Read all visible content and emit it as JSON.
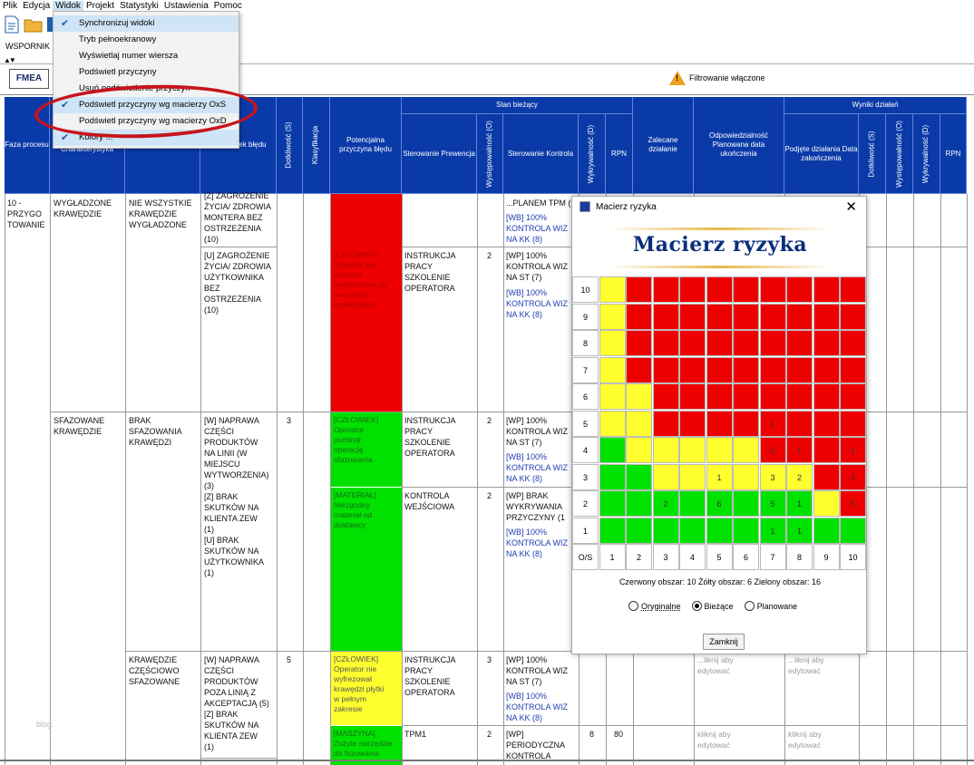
{
  "menubar": {
    "items": [
      "Plik",
      "Edycja",
      "Widok",
      "Projekt",
      "Statystyki",
      "Ustawienia",
      "Pomoc"
    ]
  },
  "toolbar": {
    "project_label": "WSPORNIK",
    "fmea_button": "FMEA",
    "filter_status": "Filtrowanie włączone"
  },
  "view_menu": {
    "items": [
      {
        "label": "Synchronizuj widoki",
        "checked": true
      },
      {
        "label": "Tryb pełnoekranowy",
        "checked": false
      },
      {
        "label": "Wyświetlaj numer wiersza",
        "checked": false
      },
      {
        "label": "Podświetl przyczyny",
        "checked": false
      },
      {
        "label": "Usuń podświetlenie przyczyn",
        "checked": false
      },
      {
        "label": "Podświetl przyczyny wg macierzy OxS",
        "checked": true
      },
      {
        "label": "Podświetl przyczyny wg macierzy OxD",
        "checked": false
      },
      {
        "label": "Kolory ...",
        "checked": true
      }
    ]
  },
  "table_header": {
    "faza": "Faza\nprocesu",
    "funkcja": "Funkcja /\nCharakterystyka",
    "rodzaj": "błędu",
    "skutek": "...ny skutek\nbłędu",
    "dotkliwosc": "Dotkliwość (S)",
    "klasyfikacja": "Klasyfikacja",
    "przyczyna": "Potencjalna\nprzyczyna błędu",
    "stan_biezacy": "Stan bieżący",
    "sterowanie_prewencja": "Sterowanie\nPrewencja",
    "wystepowalnosc": "Występowalność (O)",
    "sterowanie_kontrola": "Sterowanie\nKontrola",
    "wykrywalnosc": "Wykrywalność (D)",
    "rpn": "RPN",
    "zalecane": "Zalecane\ndziałanie",
    "odpowiedzialnosc": "Odpowiedzialność\nPlanowana data\nukończenia",
    "wyniki": "Wyniki działań",
    "podjete": "Podjęte działania\nData zakończenia",
    "dotkliwosc2": "Dotkliwość (S)",
    "wystepowalnosc2": "Występowalność (O)",
    "wykrywalnosc2": "Wykrywalność (D)",
    "rpn2": "RPN"
  },
  "rows": {
    "faza1": "10 -\nPRZYGO\nTOWANIE",
    "funkcja1": "WYGŁADZONE\nKRAWĘDZIE",
    "rodzaj1": "NIE WSZYSTKIE\nKRAWĘDZIE\nWYGŁADZONE",
    "skutek1a": "[Z] ZAGROŻENIE\nŻYCIA/ ZDROWIA\nMONTERA BEZ\nOSTRZEŻENIA\n(10)",
    "skutek1b": "[U] ZAGROŻENIE\nŻYCIA/ ZDROWIA\nUŻYTKOWNIKA\nBEZ\nOSTRZEŻENIA\n(10)",
    "przyczyna1": "[CZŁOWIEK]\nOperator nie\nwykonał\nwygładzania na\nwszystkich\nkrawędziach",
    "prewencja1": "INSTRUKCJA\nPRACY\nSZKOLENIE\nOPERATORA",
    "o1": "2",
    "kontrola1a": "...PLANEM TPM (9",
    "kontrola1b": "[WB] 100%\nKONTROLA WIZ\nNA KK (8)",
    "kontrola1c": "[WP] 100%\nKONTROLA WIZ\nNA ST (7)",
    "kontrola1d": "[WB] 100%\nKONTROLA WIZ\nNA KK (8)",
    "funkcja2": "SFAZOWANE\nKRAWĘDZIE",
    "rodzaj2": "BRAK\nSFAZOWANIA\nKRAWĘDZI",
    "skutek2": "[W] NAPRAWA\nCZĘŚCI\nPRODUKTÓW\nNA LINII (W\nMIEJSCU\nWYTWORZENIA)\n(3)\n[Z] BRAK\nSKUTKÓW NA\nKLIENTA ZEW\n(1)\n[U] BRAK\nSKUTKÓW NA\nUŻYTKOWNIKA\n(1)",
    "s2": "3",
    "przyczyna2a": "[CZŁOWIEK]\nOperator\npominął\noperację\nsfazowania",
    "prewencja2a": "INSTRUKCJA\nPRACY\nSZKOLENIE\nOPERATORA",
    "o2a": "2",
    "kontrola2a": "[WP] 100%\nKONTROLA WIZ\nNA ST (7)",
    "kontrola2b": "[WB] 100%\nKONTROLA WIZ\nNA KK (8)",
    "przyczyna2b": "[MATERIAŁ]\nNiezgodny\nmateriał od\ndostawcy",
    "prewencja2b": "KONTROLA\nWEJŚCIOWA",
    "o2b": "2",
    "kontrola2c": "[WP] BRAK\nWYKRYWANIA\nPRZYCZYNY (1",
    "kontrola2d": "[WB] 100%\nKONTROLA WIZ\nNA KK (8)",
    "rodzaj3": "KRAWĘDZIE\nCZĘŚCIOWO\nSFAZOWANE",
    "skutek3": "[W] NAPRAWA\nCZĘŚCI\nPRODUKTÓW\nPOZA LINIĄ Z\nAKCEPTACJĄ (5)\n[Z] BRAK\nSKUTKÓW NA\nKLIENTA ZEW\n(1)",
    "s3": "5",
    "przyczyna3a": "[CZŁOWIEK]\nOperator nie\nwyfrezował\nkrawędzi płytki\nw pełnym\nzakresie",
    "prewencja3a": "INSTRUKCJA\nPRACY\nSZKOLENIE\nOPERATORA",
    "o3a": "3",
    "kontrola3a": "[WP] 100%\nKONTROLA WIZ\nNA ST (7)",
    "kontrola3b": "[WB] 100%\nKONTROLA WIZ\nNA KK (8)",
    "przyczyna3b": "[MASZYNA]\nZużyte narzędzie\ndo fazowania",
    "prewencja3b": "TPM1",
    "o3b": "2",
    "kontrola3c": "[WP]\nPERIODYCZNA\nKONTROLA",
    "d3b": "8",
    "rpn3b": "80",
    "placeholder1": "...liknij aby\nedytować",
    "placeholder2": "...liknij aby\nedytować",
    "placeholder3": "kliknij aby\nedytować",
    "placeholder4": "kliknij aby\nedytować",
    "watermark": "blog"
  },
  "dialog": {
    "title": "Macierz ryzyka",
    "heading": "Macierz ryzyka",
    "os_label": "O/S",
    "x_labels": [
      "1",
      "2",
      "3",
      "4",
      "5",
      "6",
      "7",
      "8",
      "9",
      "10"
    ],
    "y_labels": [
      "10",
      "9",
      "8",
      "7",
      "6",
      "5",
      "4",
      "3",
      "2",
      "1"
    ],
    "summary": "Czerwony obszar: 10  Żółty obszar: 6  Zielony obszar: 16",
    "radio_original": "Oryginalne",
    "radio_current": "Bieżące",
    "radio_planned": "Planowane",
    "selected_radio": "Bieżące",
    "close_button": "Zamknij",
    "colors": {
      "red": "#ef0000",
      "yellow": "#ffff30",
      "green": "#00e100"
    },
    "matrix_colors": [
      "YRRRRRRRRR",
      "YRRRRRRRRR",
      "YRRRRRRRRR",
      "YRRRRRRRRR",
      "YYRRRRRRRR",
      "YYRRRRRRRR",
      "GYYYYYRRRR",
      "GGYYYYYYRR",
      "GGGGGGGGYR",
      "GGGGGGGGGG"
    ],
    "matrix_counts": [
      [
        "",
        "",
        "",
        "",
        "",
        "",
        "",
        "",
        "",
        ""
      ],
      [
        "",
        "",
        "",
        "",
        "",
        "",
        "",
        "",
        "",
        ""
      ],
      [
        "",
        "",
        "",
        "",
        "",
        "",
        "",
        "",
        "",
        ""
      ],
      [
        "",
        "",
        "",
        "",
        "",
        "",
        "",
        "",
        "",
        ""
      ],
      [
        "",
        "",
        "",
        "",
        "",
        "",
        "",
        "",
        "",
        ""
      ],
      [
        "",
        "",
        "",
        "",
        "",
        "",
        "1",
        "",
        "",
        ""
      ],
      [
        "",
        "",
        "",
        "",
        "",
        "",
        "2",
        "1",
        "",
        "1"
      ],
      [
        "",
        "",
        "",
        "",
        "1",
        "",
        "3",
        "2",
        "",
        "2"
      ],
      [
        "",
        "",
        "2",
        "",
        "6",
        "",
        "5",
        "1",
        "",
        "5"
      ],
      [
        "",
        "",
        "",
        "",
        "",
        "",
        "1",
        "1",
        "",
        ""
      ]
    ]
  }
}
